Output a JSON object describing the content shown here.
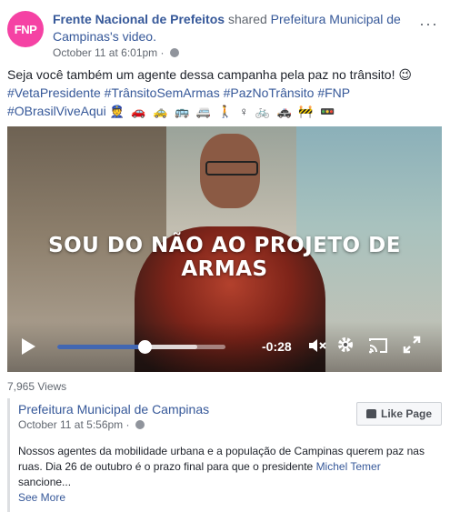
{
  "post": {
    "author": "Frente Nacional de Prefeitos",
    "action": "shared",
    "shared_page": "Prefeitura Municipal de Campinas",
    "shared_suffix": "'s video.",
    "timestamp": "October 11 at 6:01pm",
    "avatar_text": "FNP",
    "more_label": "···",
    "text": "Seja você também um agente dessa campanha pela paz no trânsito! 😉",
    "hashtags_line1": "#VetaPresidente #TrânsitoSemArmas #PazNoTrânsito #FNP",
    "hashtags_line2": "#OBrasilViveAqui",
    "emojis": "👮 🚗 🚕 🚌 🚐 🚶 ♀ 🚲 🚓 🚧 🚥"
  },
  "video": {
    "caption": "SOU DO NÃO AO PROJETO DE ARMAS",
    "time_remaining": "-0:28",
    "progress_played": 0.52,
    "progress_buffered": 0.83,
    "accent_color": "#4267b2"
  },
  "stats": {
    "views": "7,965 Views"
  },
  "shared_card": {
    "page_name": "Prefeitura Municipal de Campinas",
    "timestamp": "October 11 at 5:56pm",
    "like_button": "Like Page",
    "body_part1": "Nossos agentes da mobilidade urbana e a população de Campinas querem paz nas ruas. Dia 26 de outubro é o prazo final para que o presidente ",
    "mention": "Michel Temer",
    "body_part2": " sancione...",
    "see_more": "See More"
  }
}
